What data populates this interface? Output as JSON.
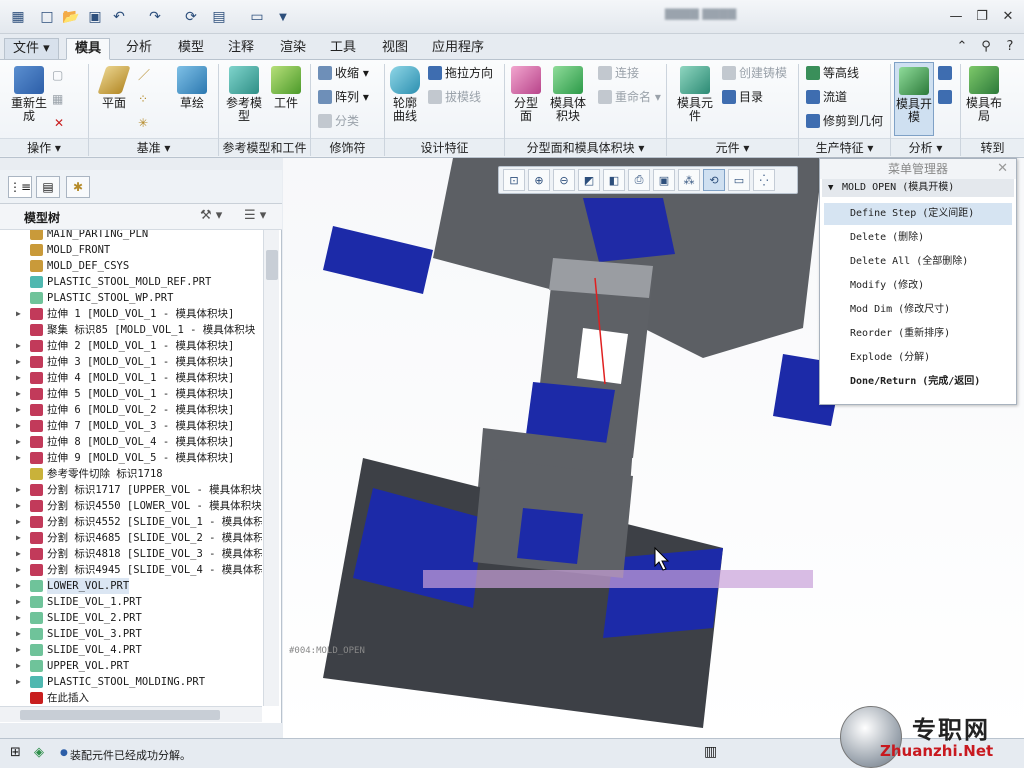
{
  "ribbon_tabs": [
    "文件",
    "模具",
    "分析",
    "模型",
    "注释",
    "渲染",
    "工具",
    "视图",
    "应用程序"
  ],
  "ribbon": {
    "regenerate": "重新生成",
    "plane": "平面",
    "sketch": "草绘",
    "ref_model": "参考模型",
    "workpiece": "工件",
    "shrink": "收缩",
    "pattern": "阵列",
    "classify": "分类",
    "silhouette": "轮廓曲线",
    "draft_direction": "拖拉方向",
    "draft_line": "拔模线",
    "parting_surface": "分型面",
    "mold_volume": "模具体积块",
    "connect": "连接",
    "rename": "重命名",
    "mold_component": "模具元件",
    "create_casting": "创建铸模",
    "catalog": "目录",
    "contour": "等高线",
    "flow": "流道",
    "trim_geometry": "修剪到几何",
    "mold_open": "模具开模",
    "mold_layout": "模具布局"
  },
  "groups": [
    "操作",
    "基准",
    "参考模型和工件",
    "修饰符",
    "设计特征",
    "分型面和模具体积块",
    "元件",
    "生产特征",
    "分析",
    "转到"
  ],
  "model_tree": {
    "title": "模型树",
    "items": [
      {
        "label": "MAIN_PARTING_PLN",
        "expand": "",
        "icon": "plane-icon",
        "color": "#c99a3a"
      },
      {
        "label": "MOLD_FRONT",
        "expand": "",
        "icon": "plane-icon",
        "color": "#c99a3a"
      },
      {
        "label": "MOLD_DEF_CSYS",
        "expand": "",
        "icon": "csys-icon",
        "color": "#c99a3a"
      },
      {
        "label": "PLASTIC_STOOL_MOLD_REF.PRT",
        "expand": "",
        "icon": "part-icon",
        "color": "#4fb8b0"
      },
      {
        "label": "PLASTIC_STOOL_WP.PRT",
        "expand": "",
        "icon": "part-icon",
        "color": "#6fc39a"
      },
      {
        "label": "拉伸 1 [MOLD_VOL_1 - 模具体积块]",
        "expand": "▶",
        "icon": "extrude-icon",
        "color": "#c23a5a"
      },
      {
        "label": "聚集 标识85 [MOLD_VOL_1 - 模具体积块",
        "expand": "",
        "icon": "gather-icon",
        "color": "#c23a5a"
      },
      {
        "label": "拉伸 2 [MOLD_VOL_1 - 模具体积块]",
        "expand": "▶",
        "icon": "extrude-icon",
        "color": "#c23a5a"
      },
      {
        "label": "拉伸 3 [MOLD_VOL_1 - 模具体积块]",
        "expand": "▶",
        "icon": "extrude-icon",
        "color": "#c23a5a"
      },
      {
        "label": "拉伸 4 [MOLD_VOL_1 - 模具体积块]",
        "expand": "▶",
        "icon": "extrude-icon",
        "color": "#c23a5a"
      },
      {
        "label": "拉伸 5 [MOLD_VOL_1 - 模具体积块]",
        "expand": "▶",
        "icon": "extrude-icon",
        "color": "#c23a5a"
      },
      {
        "label": "拉伸 6 [MOLD_VOL_2 - 模具体积块]",
        "expand": "▶",
        "icon": "extrude-icon",
        "color": "#c23a5a"
      },
      {
        "label": "拉伸 7 [MOLD_VOL_3 - 模具体积块]",
        "expand": "▶",
        "icon": "extrude-icon",
        "color": "#c23a5a"
      },
      {
        "label": "拉伸 8 [MOLD_VOL_4 - 模具体积块]",
        "expand": "▶",
        "icon": "extrude-icon",
        "color": "#c23a5a"
      },
      {
        "label": "拉伸 9 [MOLD_VOL_5 - 模具体积块]",
        "expand": "▶",
        "icon": "extrude-icon",
        "color": "#c23a5a"
      },
      {
        "label": "参考零件切除 标识1718",
        "expand": "",
        "icon": "cut-icon",
        "color": "#c9b23a"
      },
      {
        "label": "分割 标识1717 [UPPER_VOL - 模具体积块",
        "expand": "▶",
        "icon": "split-icon",
        "color": "#c23a5a"
      },
      {
        "label": "分割 标识4550 [LOWER_VOL - 模具体积块",
        "expand": "▶",
        "icon": "split-icon",
        "color": "#c23a5a"
      },
      {
        "label": "分割 标识4552 [SLIDE_VOL_1 - 模具体积",
        "expand": "▶",
        "icon": "split-icon",
        "color": "#c23a5a"
      },
      {
        "label": "分割 标识4685 [SLIDE_VOL_2 - 模具体积",
        "expand": "▶",
        "icon": "split-icon",
        "color": "#c23a5a"
      },
      {
        "label": "分割 标识4818 [SLIDE_VOL_3 - 模具体积",
        "expand": "▶",
        "icon": "split-icon",
        "color": "#c23a5a"
      },
      {
        "label": "分割 标识4945 [SLIDE_VOL_4 - 模具体积",
        "expand": "▶",
        "icon": "split-icon",
        "color": "#c23a5a"
      },
      {
        "label": "LOWER_VOL.PRT",
        "expand": "▶",
        "icon": "part-icon",
        "color": "#6fc39a",
        "selected": true
      },
      {
        "label": "SLIDE_VOL_1.PRT",
        "expand": "▶",
        "icon": "part-icon",
        "color": "#6fc39a"
      },
      {
        "label": "SLIDE_VOL_2.PRT",
        "expand": "▶",
        "icon": "part-icon",
        "color": "#6fc39a"
      },
      {
        "label": "SLIDE_VOL_3.PRT",
        "expand": "▶",
        "icon": "part-icon",
        "color": "#6fc39a"
      },
      {
        "label": "SLIDE_VOL_4.PRT",
        "expand": "▶",
        "icon": "part-icon",
        "color": "#6fc39a"
      },
      {
        "label": "UPPER_VOL.PRT",
        "expand": "▶",
        "icon": "part-icon",
        "color": "#6fc39a"
      },
      {
        "label": "PLASTIC_STOOL_MOLDING.PRT",
        "expand": "▶",
        "icon": "part-icon",
        "color": "#4fb8b0"
      },
      {
        "label": "在此插入",
        "expand": "",
        "icon": "insert-arrow-icon",
        "color": "#c81e1e"
      }
    ]
  },
  "menu_manager": {
    "title": "菜单管理器",
    "submenu": "MOLD OPEN (模具开模)",
    "items": [
      {
        "label": "Define Step (定义间距)",
        "highlight": true
      },
      {
        "label": "Delete (删除)"
      },
      {
        "label": "Delete All (全部删除)"
      },
      {
        "label": "Modify (修改)"
      },
      {
        "label": "Mod Dim (修改尺寸)"
      },
      {
        "label": "Reorder (重新排序)"
      },
      {
        "label": "Explode (分解)"
      },
      {
        "label": "Done/Return (完成/返回)",
        "bold": true
      }
    ]
  },
  "graphics": {
    "mold_label": "#004:MOLD_OPEN"
  },
  "status": {
    "message": "装配元件已经成功分解。"
  },
  "watermark": {
    "cn": "专职网",
    "url": "Zhuanzhi.Net"
  }
}
